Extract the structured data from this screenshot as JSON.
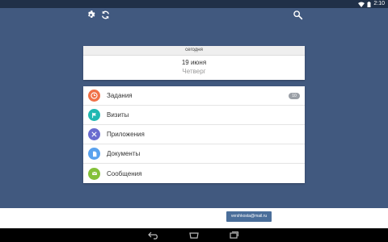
{
  "status_bar": {
    "time": "2:10",
    "icons": [
      "wifi-icon",
      "battery-icon"
    ]
  },
  "toolbar": {
    "icons": [
      "gear-icon",
      "refresh-icon",
      "search-icon"
    ]
  },
  "date_card": {
    "today_label": "сегодня",
    "date": "19 июня",
    "weekday": "Четверг"
  },
  "menu": {
    "items": [
      {
        "label": "Задания",
        "icon": "clock-icon",
        "color": "#f07148",
        "badge": "10"
      },
      {
        "label": "Визиты",
        "icon": "flag-icon",
        "color": "#21b8b2"
      },
      {
        "label": "Приложения",
        "icon": "apps-icon",
        "color": "#6a6ccf"
      },
      {
        "label": "Документы",
        "icon": "document-icon",
        "color": "#5aa2ee"
      },
      {
        "label": "Сообщения",
        "icon": "message-icon",
        "color": "#84c13a"
      }
    ]
  },
  "bottom": {
    "email": "vershkosta@mail.ru"
  },
  "colors": {
    "background": "#41597f",
    "button": "#4a6e9a"
  }
}
